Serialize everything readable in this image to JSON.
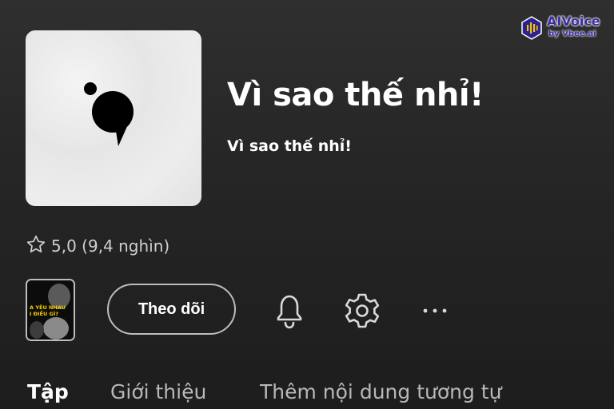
{
  "podcast": {
    "title": "Vì sao thế nhỉ!",
    "author": "Vì sao thế nhỉ!",
    "rating": "5,0 (9,4 nghìn)"
  },
  "thumbnail": {
    "text": "A YÊU NHAU\nI ĐIỀU GÌ?"
  },
  "actions": {
    "follow_label": "Theo dõi",
    "bell_icon": "bell-icon",
    "settings_icon": "gear-icon",
    "more_icon": "more-horizontal-icon"
  },
  "tabs": [
    {
      "label": "Tập",
      "active": true
    },
    {
      "label": "Giới thiệu",
      "active": false
    },
    {
      "label": "Thêm nội dung tương tự",
      "active": false
    }
  ],
  "watermark": {
    "name": "AIVoice",
    "sub": "by Vbee.ai"
  },
  "colors": {
    "background": "#262626",
    "text": "#ffffff",
    "muted": "#b8b8b8",
    "brand": "#3a2fa0"
  }
}
